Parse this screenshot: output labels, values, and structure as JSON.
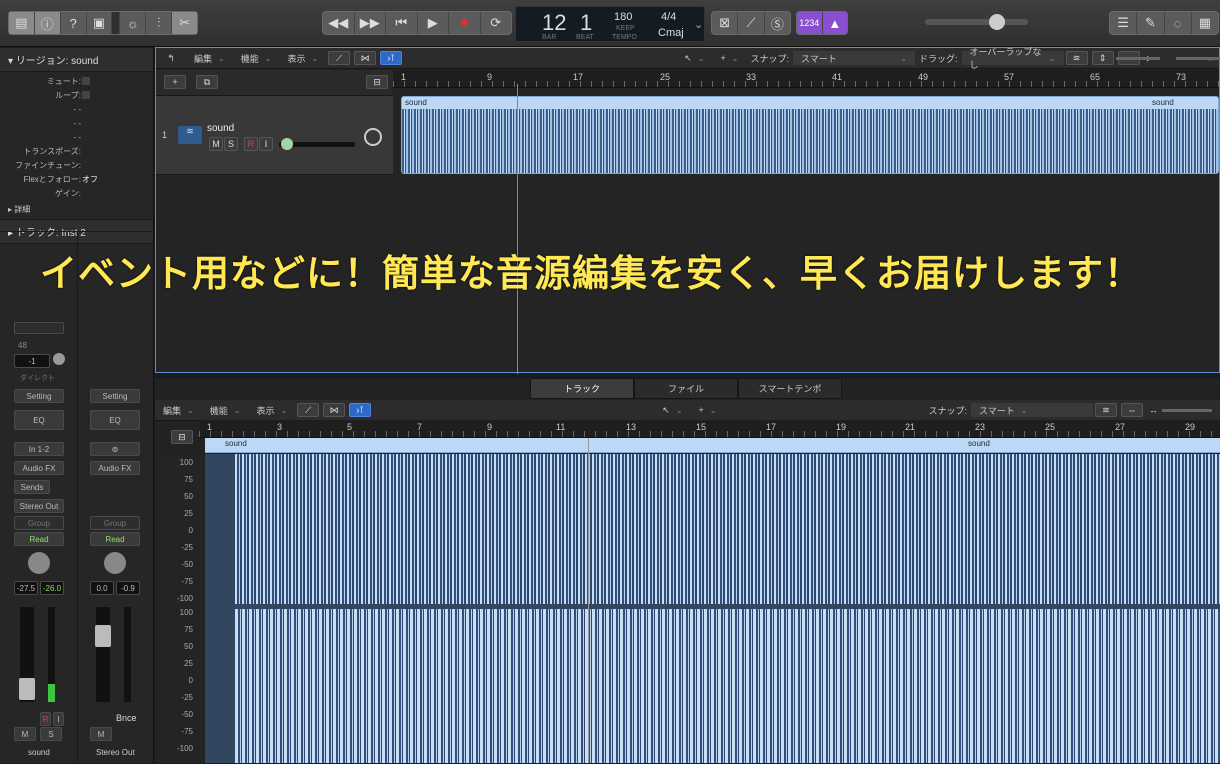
{
  "control_bar": {
    "lcd": {
      "bar": "12",
      "beat": "1",
      "bar_label": "BAR",
      "beat_label": "BEAT",
      "tempo": "180",
      "keep": "KEEP",
      "tempo_label": "TEMPO",
      "time_sig": "4/4",
      "key": "Cmaj"
    },
    "count_in": "1234",
    "master_volume": 0.68
  },
  "inspector": {
    "region_header": "リージョン: sound",
    "rows": [
      {
        "label": "ミュート:",
        "value": ""
      },
      {
        "label": "ループ:",
        "value": ""
      },
      {
        "label": "- -",
        "value": ""
      },
      {
        "label": "- -",
        "value": ""
      },
      {
        "label": "- -",
        "value": ""
      },
      {
        "label": "トランスポーズ:",
        "value": ""
      },
      {
        "label": "ファインチューン:",
        "value": ""
      },
      {
        "label": "Flexとフォロー:",
        "value": "オフ"
      },
      {
        "label": "ゲイン:",
        "value": ""
      }
    ],
    "details": "詳細",
    "track_header": "トラック: Inst 2",
    "strip1": {
      "num": "48",
      "pan": "-1",
      "direct": "ダイレクト",
      "setting": "Setting",
      "eq": "EQ",
      "input": "In 1-2",
      "fx": "Audio FX",
      "sends": "Sends",
      "output": "Stereo Out",
      "group": "Group",
      "read": "Read",
      "vol_a": "-27.5",
      "vol_b": "-26.0",
      "r": "R",
      "i": "I",
      "m": "M",
      "s": "S",
      "name": "sound"
    },
    "strip2": {
      "setting": "Setting",
      "eq": "EQ",
      "fx": "Audio FX",
      "group": "Group",
      "read": "Read",
      "vol_a": "0.0",
      "vol_b": "-0.9",
      "bnce": "Bnce",
      "m": "M",
      "name": "Stereo Out"
    }
  },
  "tracks_area": {
    "menu": [
      "編集",
      "機能",
      "表示"
    ],
    "snap_label": "スナップ:",
    "snap_value": "スマート",
    "drag_label": "ドラッグ:",
    "drag_value": "オーバーラップなし",
    "ruler": [
      "1",
      "9",
      "17",
      "25",
      "33",
      "41",
      "49",
      "57",
      "65",
      "73"
    ],
    "track": {
      "num": "1",
      "name": "sound",
      "m": "M",
      "s": "S",
      "r": "R",
      "i": "I"
    },
    "region_name": "sound",
    "region_name2": "sound"
  },
  "editor": {
    "tabs": [
      "トラック",
      "ファイル",
      "スマートテンポ"
    ],
    "menu": [
      "編集",
      "機能",
      "表示"
    ],
    "snap_label": "スナップ:",
    "snap_value": "スマート",
    "ruler": [
      "1",
      "3",
      "5",
      "7",
      "9",
      "11",
      "13",
      "15",
      "17",
      "19",
      "21",
      "23",
      "25",
      "27",
      "29"
    ],
    "region_name": "sound",
    "region_name2": "sound",
    "scale": [
      "100",
      "75",
      "50",
      "25",
      "0",
      "-25",
      "-50",
      "-75",
      "-100",
      "100",
      "75",
      "50",
      "25",
      "0",
      "-25",
      "-50",
      "-75",
      "-100"
    ]
  },
  "overlay": "イベント用などに！簡単な音源編集を安く、早くお届けします！"
}
